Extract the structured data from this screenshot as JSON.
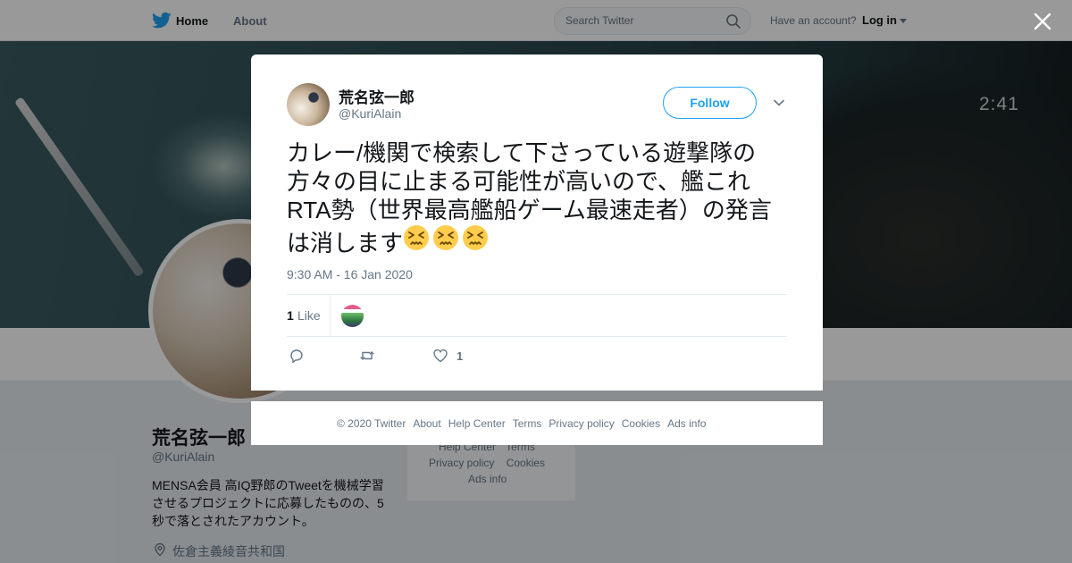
{
  "nav": {
    "home_label": "Home",
    "about_label": "About",
    "search_placeholder": "Search Twitter",
    "have_account": "Have an account?",
    "login_label": "Log in"
  },
  "banner": {
    "video_time": "2:41"
  },
  "profile": {
    "name": "荒名弦一郎",
    "handle": "@KuriAlain",
    "bio": "MENSA会員 高IQ野郎のTweetを機械学習させるプロジェクトに応募したものの、5秒で落とされたアカウント。",
    "location": "佐倉主義綾音共和国"
  },
  "side_footer": {
    "row1": [
      "Help Center",
      "Terms"
    ],
    "row2": [
      "Privacy policy",
      "Cookies"
    ],
    "row3": "Ads info"
  },
  "tweet": {
    "author_name": "荒名弦一郎",
    "author_handle": "@KuriAlain",
    "follow_label": "Follow",
    "text": "カレー/機関で検索して下さっている遊撃隊の方々の目に止まる可能性が高いので、艦これRTA勢（世界最高艦船ゲーム最速走者）の発言は消します",
    "emoji_count": 3,
    "timestamp": "9:30 AM - 16 Jan 2020",
    "likes_count": "1",
    "likes_label": "Like",
    "action_like_count": "1"
  },
  "modal_footer": {
    "links": [
      "© 2020 Twitter",
      "About",
      "Help Center",
      "Terms",
      "Privacy policy",
      "Cookies",
      "Ads info"
    ]
  },
  "colors": {
    "accent": "#1da1f2",
    "muted": "#657786",
    "text": "#14171a"
  },
  "icons": [
    "twitter-bird-icon",
    "search-icon",
    "close-icon",
    "chevron-down-icon",
    "reply-icon",
    "retweet-icon",
    "heart-icon",
    "location-pin-icon",
    "persevering-face-emoji"
  ]
}
